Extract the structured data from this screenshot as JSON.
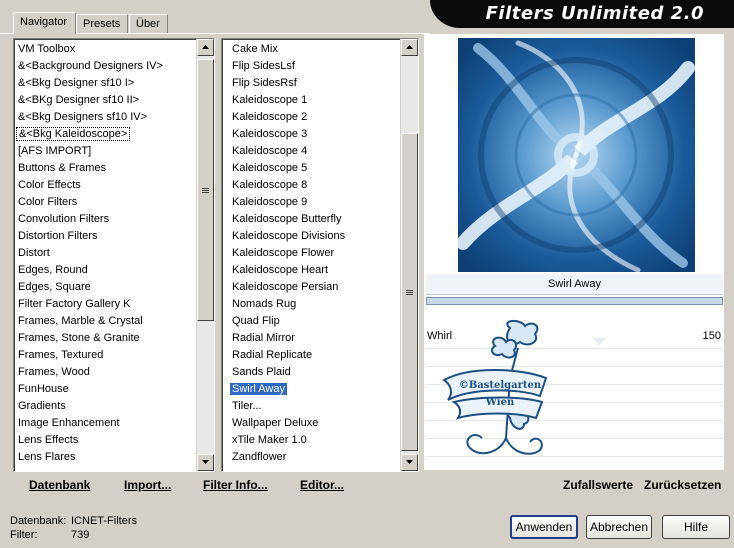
{
  "window": {
    "title": "Filters Unlimited 2.0"
  },
  "tabs": [
    "Navigator",
    "Presets",
    "Über"
  ],
  "categories": [
    "VM Toolbox",
    "&<Background Designers IV>",
    "&<Bkg Designer sf10 I>",
    "&<BKg Designer sf10 II>",
    "&<Bkg Designers sf10 IV>",
    "&<Bkg Kaleidoscope>",
    "[AFS IMPORT]",
    "Buttons & Frames",
    "Color Effects",
    "Color Filters",
    "Convolution Filters",
    "Distortion Filters",
    "Distort",
    "Edges, Round",
    "Edges, Square",
    "Filter Factory Gallery K",
    "Frames, Marble & Crystal",
    "Frames, Stone & Granite",
    "Frames, Textured",
    "Frames, Wood",
    "FunHouse",
    "Gradients",
    "Image Enhancement",
    "Lens Effects",
    "Lens Flares"
  ],
  "filters": [
    "Cake Mix",
    "Flip SidesLsf",
    "Flip SidesRsf",
    "Kaleidoscope 1",
    "Kaleidoscope 2",
    "Kaleidoscope 3",
    "Kaleidoscope 4",
    "Kaleidoscope 5",
    "Kaleidoscope 8",
    "Kaleidoscope 9",
    "Kaleidoscope Butterfly",
    "Kaleidoscope Divisions",
    "Kaleidoscope Flower",
    "Kaleidoscope Heart",
    "Kaleidoscope Persian",
    "Nomads Rug",
    "Quad Flip",
    "Radial Mirror",
    "Radial Replicate",
    "Sands Plaid",
    "Swirl Away",
    "Tiler...",
    "Wallpaper Deluxe",
    "xTile Maker 1.0",
    "Zandflower"
  ],
  "selected_category_index": 5,
  "selected_filter_index": 20,
  "preview": {
    "filter_name": "Swirl Away"
  },
  "param": {
    "label": "Whirl",
    "value": "150"
  },
  "watermark": {
    "line1": "©Bastelgarten",
    "line2": "Wien"
  },
  "links_left": {
    "database": "Datenbank",
    "import": "Import...",
    "filter_info": "Filter Info...",
    "editor": "Editor..."
  },
  "links_right": {
    "random": "Zufallswerte",
    "reset": "Zurücksetzen"
  },
  "status": {
    "db_label": "Datenbank:",
    "db_value": "ICNET-Filters",
    "filter_label": "Filter:",
    "filter_value": "739"
  },
  "buttons": {
    "apply": "Anwenden",
    "cancel": "Abbrechen",
    "help": "Hilfe"
  },
  "colors": {
    "accent": "#316ac5",
    "preview_blue": "#1f5f9f",
    "banner": "#0a0a0a"
  }
}
